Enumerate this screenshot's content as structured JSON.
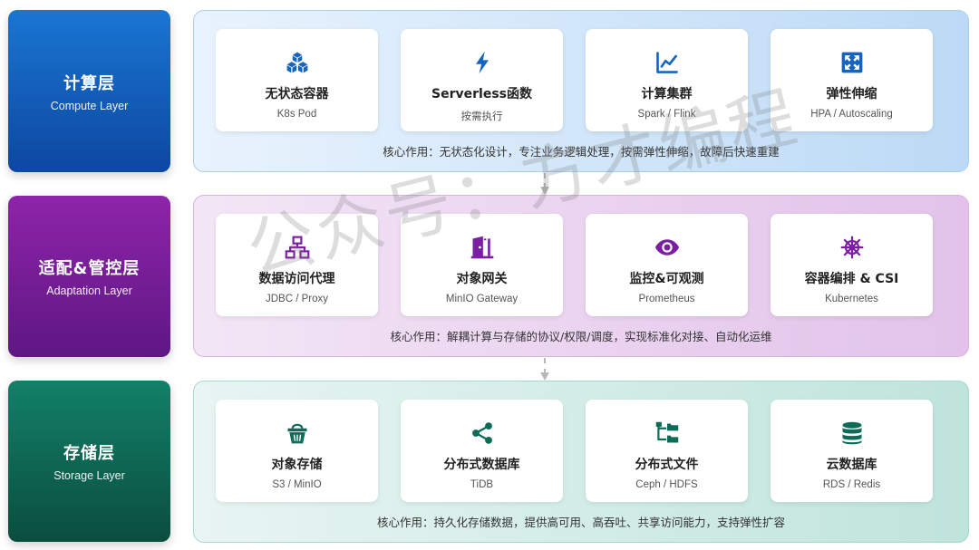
{
  "colors": {
    "compute": "#1565c0",
    "adaptation": "#7b1fa2",
    "storage": "#0e6b57"
  },
  "layers": [
    {
      "title": "计算层",
      "subtitle": "Compute Layer",
      "role": "核心作用：无状态化设计，专注业务逻辑处理，按需弹性伸缩，故障后快速重建",
      "cards": [
        {
          "icon": "cubes-icon",
          "title": "无状态容器",
          "sub": "K8s Pod"
        },
        {
          "icon": "bolt-icon",
          "title": "Serverless函数",
          "sub": "按需执行"
        },
        {
          "icon": "line-chart-icon",
          "title": "计算集群",
          "sub": "Spark / Flink"
        },
        {
          "icon": "expand-arrows-icon",
          "title": "弹性伸缩",
          "sub": "HPA / Autoscaling"
        }
      ]
    },
    {
      "title": "适配&管控层",
      "subtitle": "Adaptation Layer",
      "role": "核心作用：解耦计算与存储的协议/权限/调度，实现标准化对接、自动化运维",
      "cards": [
        {
          "icon": "network-icon",
          "title": "数据访问代理",
          "sub": "JDBC / Proxy"
        },
        {
          "icon": "door-icon",
          "title": "对象网关",
          "sub": "MinIO Gateway"
        },
        {
          "icon": "eye-icon",
          "title": "监控&可观测",
          "sub": "Prometheus"
        },
        {
          "icon": "helm-icon",
          "title": "容器编排 & CSI",
          "sub": "Kubernetes"
        }
      ]
    },
    {
      "title": "存储层",
      "subtitle": "Storage Layer",
      "role": "核心作用：持久化存储数据，提供高可用、高吞吐、共享访问能力，支持弹性扩容",
      "cards": [
        {
          "icon": "bucket-icon",
          "title": "对象存储",
          "sub": "S3 / MinIO"
        },
        {
          "icon": "share-nodes-icon",
          "title": "分布式数据库",
          "sub": "TiDB"
        },
        {
          "icon": "folder-tree-icon",
          "title": "分布式文件",
          "sub": "Ceph / HDFS"
        },
        {
          "icon": "database-icon",
          "title": "云数据库",
          "sub": "RDS / Redis"
        }
      ]
    }
  ],
  "watermark": "公众号：方才编程"
}
